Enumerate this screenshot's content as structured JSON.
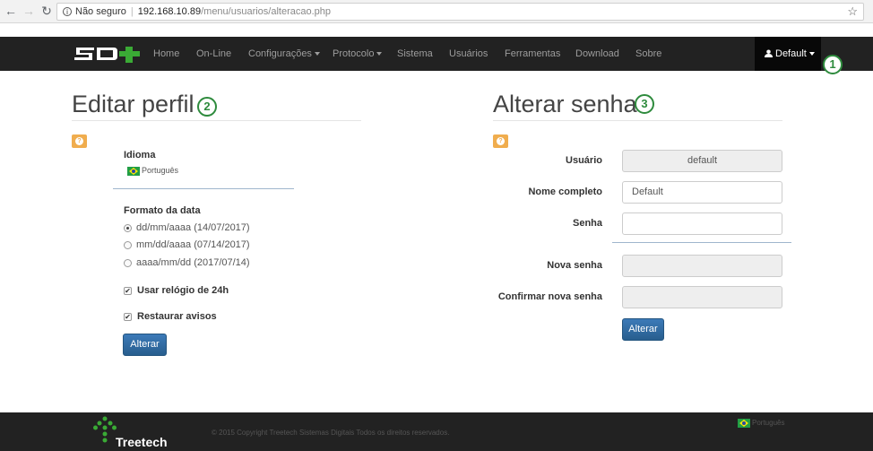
{
  "browser": {
    "security_label": "Não seguro",
    "url_host": "192.168.10.89",
    "url_path": "/menu/usuarios/alteracao.php"
  },
  "navbar": {
    "brand": "SD+",
    "items": [
      {
        "label": "Home"
      },
      {
        "label": "On-Line"
      },
      {
        "label": "Configurações",
        "dropdown": true
      },
      {
        "label": "Protocolo",
        "dropdown": true
      },
      {
        "label": "Sistema"
      },
      {
        "label": "Usuários"
      },
      {
        "label": "Ferramentas"
      },
      {
        "label": "Download"
      },
      {
        "label": "Sobre"
      }
    ],
    "user_menu": "Default"
  },
  "callouts": [
    "1",
    "2",
    "3"
  ],
  "edit_profile": {
    "title": "Editar perfil",
    "language_label": "Idioma",
    "language_value": "Português",
    "date_format_label": "Formato da data",
    "date_options": [
      {
        "label": "dd/mm/aaaa (14/07/2017)",
        "checked": true
      },
      {
        "label": "mm/dd/aaaa (07/14/2017)",
        "checked": false
      },
      {
        "label": "aaaa/mm/dd (2017/07/14)",
        "checked": false
      }
    ],
    "clock_24h_label": "Usar relógio de 24h",
    "clock_24h_checked": true,
    "restore_alerts_label": "Restaurar avisos",
    "restore_alerts_checked": true,
    "submit_label": "Alterar"
  },
  "change_password": {
    "title": "Alterar senha",
    "user_label": "Usuário",
    "user_value": "default",
    "fullname_label": "Nome completo",
    "fullname_value": "Default",
    "password_label": "Senha",
    "password_value": "",
    "new_password_label": "Nova senha",
    "confirm_password_label": "Confirmar nova senha",
    "submit_label": "Alterar"
  },
  "footer": {
    "copyright": "© 2015 Copyright Treetech Sistemas Digitais   Todos os direitos reservados.",
    "language": "Português",
    "brand": "Treetech"
  },
  "colors": {
    "navbar_bg": "#222222",
    "callout_green": "#2e8b3d",
    "help_orange": "#f0ad4e",
    "primary_blue": "#337ab7",
    "logo_green": "#3aaa35"
  }
}
